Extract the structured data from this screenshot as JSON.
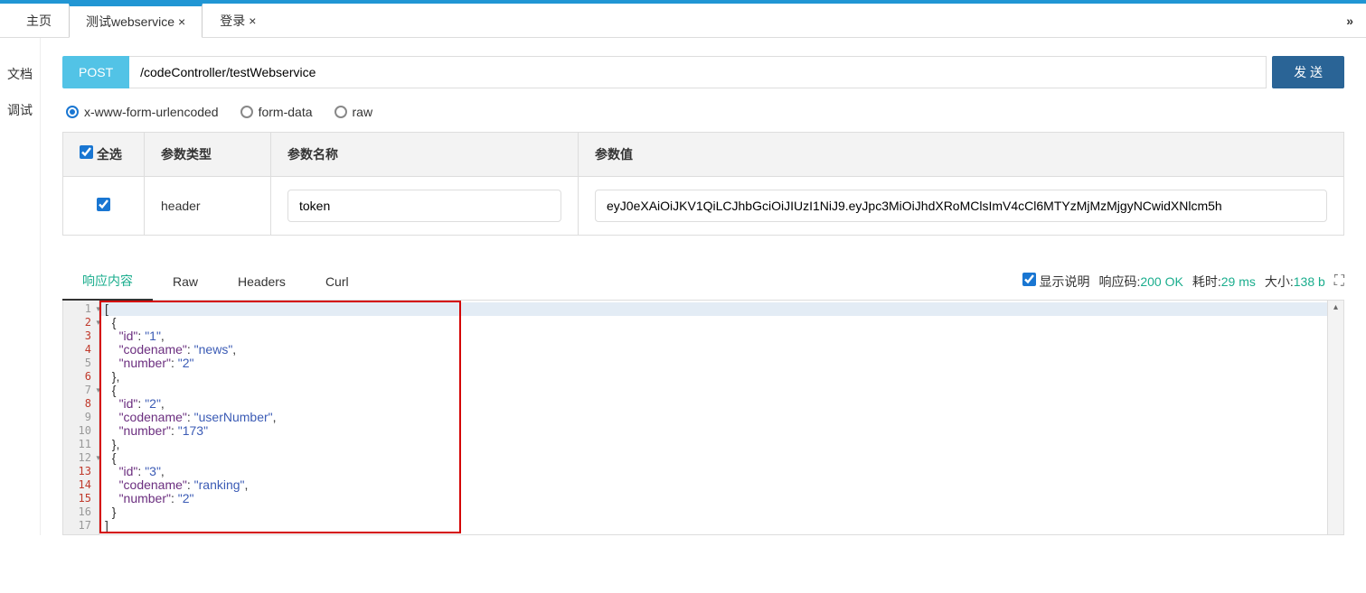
{
  "tabs": {
    "items": [
      {
        "label": "主页",
        "closable": false
      },
      {
        "label": "测试webservice",
        "closable": true
      },
      {
        "label": "登录",
        "closable": true
      }
    ],
    "overflow_glyph": "»"
  },
  "sidebar": {
    "items": [
      {
        "label": "文档"
      },
      {
        "label": "调试"
      }
    ]
  },
  "request": {
    "method": "POST",
    "url": "/codeController/testWebservice",
    "send_label": "发 送"
  },
  "body_types": {
    "options": [
      "x-www-form-urlencoded",
      "form-data",
      "raw"
    ],
    "selected": "x-www-form-urlencoded"
  },
  "params": {
    "select_all_label": "全选",
    "col_type": "参数类型",
    "col_name": "参数名称",
    "col_value": "参数值",
    "rows": [
      {
        "checked": true,
        "type": "header",
        "name": "token",
        "value": "eyJ0eXAiOiJKV1QiLCJhbGciOiJIUzI1NiJ9.eyJpc3MiOiJhdXRoMClsImV4cCl6MTYzMjMzMjgyNCwidXNlcm5h"
      }
    ]
  },
  "response": {
    "tabs": [
      "响应内容",
      "Raw",
      "Headers",
      "Curl"
    ],
    "active_tab": "响应内容",
    "show_desc_label": "显示说明",
    "show_desc_checked": true,
    "status_label": "响应码:",
    "status_value": "200 OK",
    "time_label": "耗时:",
    "time_value": "29 ms",
    "size_label": "大小:",
    "size_value": "138 b",
    "code_lines": [
      {
        "n": 1,
        "fold": true,
        "hl": true,
        "tokens": [
          {
            "t": "[",
            "c": "punc"
          }
        ]
      },
      {
        "n": 2,
        "fold": true,
        "tokens": [
          {
            "t": "  {",
            "c": "punc"
          }
        ]
      },
      {
        "n": 3,
        "tokens": [
          {
            "t": "    ",
            "c": "punc"
          },
          {
            "t": "\"id\"",
            "c": "key"
          },
          {
            "t": ": ",
            "c": "punc"
          },
          {
            "t": "\"1\"",
            "c": "str"
          },
          {
            "t": ",",
            "c": "punc"
          }
        ]
      },
      {
        "n": 4,
        "tokens": [
          {
            "t": "    ",
            "c": "punc"
          },
          {
            "t": "\"codename\"",
            "c": "key"
          },
          {
            "t": ": ",
            "c": "punc"
          },
          {
            "t": "\"news\"",
            "c": "str"
          },
          {
            "t": ",",
            "c": "punc"
          }
        ]
      },
      {
        "n": 5,
        "tokens": [
          {
            "t": "    ",
            "c": "punc"
          },
          {
            "t": "\"number\"",
            "c": "key"
          },
          {
            "t": ": ",
            "c": "punc"
          },
          {
            "t": "\"2\"",
            "c": "str"
          }
        ]
      },
      {
        "n": 6,
        "tokens": [
          {
            "t": "  },",
            "c": "punc"
          }
        ]
      },
      {
        "n": 7,
        "fold": true,
        "tokens": [
          {
            "t": "  {",
            "c": "punc"
          }
        ]
      },
      {
        "n": 8,
        "tokens": [
          {
            "t": "    ",
            "c": "punc"
          },
          {
            "t": "\"id\"",
            "c": "key"
          },
          {
            "t": ": ",
            "c": "punc"
          },
          {
            "t": "\"2\"",
            "c": "str"
          },
          {
            "t": ",",
            "c": "punc"
          }
        ]
      },
      {
        "n": 9,
        "tokens": [
          {
            "t": "    ",
            "c": "punc"
          },
          {
            "t": "\"codename\"",
            "c": "key"
          },
          {
            "t": ": ",
            "c": "punc"
          },
          {
            "t": "\"userNumber\"",
            "c": "str"
          },
          {
            "t": ",",
            "c": "punc"
          }
        ]
      },
      {
        "n": 10,
        "tokens": [
          {
            "t": "    ",
            "c": "punc"
          },
          {
            "t": "\"number\"",
            "c": "key"
          },
          {
            "t": ": ",
            "c": "punc"
          },
          {
            "t": "\"173\"",
            "c": "str"
          }
        ]
      },
      {
        "n": 11,
        "tokens": [
          {
            "t": "  },",
            "c": "punc"
          }
        ]
      },
      {
        "n": 12,
        "fold": true,
        "tokens": [
          {
            "t": "  {",
            "c": "punc"
          }
        ]
      },
      {
        "n": 13,
        "tokens": [
          {
            "t": "    ",
            "c": "punc"
          },
          {
            "t": "\"id\"",
            "c": "key"
          },
          {
            "t": ": ",
            "c": "punc"
          },
          {
            "t": "\"3\"",
            "c": "str"
          },
          {
            "t": ",",
            "c": "punc"
          }
        ]
      },
      {
        "n": 14,
        "tokens": [
          {
            "t": "    ",
            "c": "punc"
          },
          {
            "t": "\"codename\"",
            "c": "key"
          },
          {
            "t": ": ",
            "c": "punc"
          },
          {
            "t": "\"ranking\"",
            "c": "str"
          },
          {
            "t": ",",
            "c": "punc"
          }
        ]
      },
      {
        "n": 15,
        "tokens": [
          {
            "t": "    ",
            "c": "punc"
          },
          {
            "t": "\"number\"",
            "c": "key"
          },
          {
            "t": ": ",
            "c": "punc"
          },
          {
            "t": "\"2\"",
            "c": "str"
          }
        ]
      },
      {
        "n": 16,
        "tokens": [
          {
            "t": "  }",
            "c": "punc"
          }
        ]
      },
      {
        "n": 17,
        "tokens": [
          {
            "t": "]",
            "c": "punc"
          }
        ]
      }
    ]
  }
}
